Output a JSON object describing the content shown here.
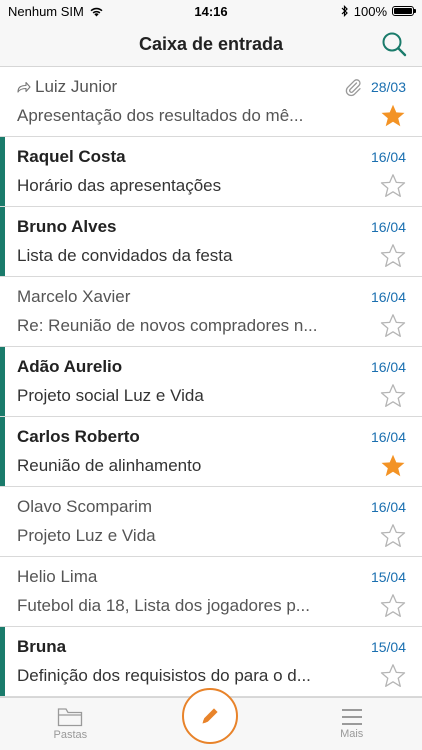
{
  "status": {
    "carrier": "Nenhum SIM",
    "time": "14:16",
    "battery": "100%"
  },
  "header": {
    "title": "Caixa de entrada"
  },
  "colors": {
    "accent": "#1a7b6b",
    "date": "#1a6fb0",
    "star": "#f39325",
    "compose": "#e8832a"
  },
  "emails": [
    {
      "sender": "Luiz Junior",
      "date": "28/03",
      "subject": "Apresentação dos resultados do mê...",
      "unread": false,
      "starred": true,
      "forwarded": true,
      "attachment": true
    },
    {
      "sender": "Raquel Costa",
      "date": "16/04",
      "subject": "Horário das apresentações",
      "unread": true,
      "starred": false
    },
    {
      "sender": "Bruno Alves",
      "date": "16/04",
      "subject": "Lista de convidados da festa",
      "unread": true,
      "starred": false
    },
    {
      "sender": "Marcelo Xavier",
      "date": "16/04",
      "subject": "Re: Reunião de novos compradores n...",
      "unread": false,
      "starred": false
    },
    {
      "sender": "Adão Aurelio",
      "date": "16/04",
      "subject": "Projeto social Luz e Vida",
      "unread": true,
      "starred": false
    },
    {
      "sender": "Carlos Roberto",
      "date": "16/04",
      "subject": "Reunião de alinhamento",
      "unread": true,
      "starred": true
    },
    {
      "sender": "Olavo Scomparim",
      "date": "16/04",
      "subject": "Projeto Luz e Vida",
      "unread": false,
      "starred": false
    },
    {
      "sender": "Helio Lima",
      "date": "15/04",
      "subject": "Futebol dia 18, Lista dos jogadores p...",
      "unread": false,
      "starred": false
    },
    {
      "sender": "Bruna",
      "date": "15/04",
      "subject": "Definição dos requisistos do para o d...",
      "unread": true,
      "starred": false
    }
  ],
  "tabbar": {
    "folders_label": "Pastas",
    "more_label": "Mais"
  }
}
